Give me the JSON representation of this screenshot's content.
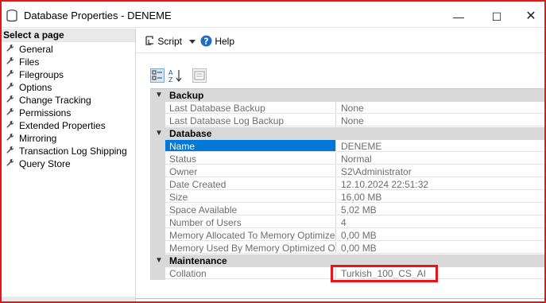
{
  "window": {
    "title": "Database Properties - DENEME",
    "minimize": "—",
    "maximize": "☐",
    "close": "✕"
  },
  "left_panel": {
    "header": "Select a page",
    "items": [
      {
        "label": "General"
      },
      {
        "label": "Files"
      },
      {
        "label": "Filegroups"
      },
      {
        "label": "Options"
      },
      {
        "label": "Change Tracking"
      },
      {
        "label": "Permissions"
      },
      {
        "label": "Extended Properties"
      },
      {
        "label": "Mirroring"
      },
      {
        "label": "Transaction Log Shipping"
      },
      {
        "label": "Query Store"
      }
    ]
  },
  "toolbar": {
    "script_label": "Script",
    "help_label": "Help"
  },
  "grid": {
    "categories": [
      {
        "name": "Backup",
        "rows": [
          {
            "name": "Last Database Backup",
            "value": "None"
          },
          {
            "name": "Last Database Log Backup",
            "value": "None"
          }
        ]
      },
      {
        "name": "Database",
        "rows": [
          {
            "name": "Name",
            "value": "DENEME",
            "selected": true
          },
          {
            "name": "Status",
            "value": "Normal"
          },
          {
            "name": "Owner",
            "value": "S2\\Administrator"
          },
          {
            "name": "Date Created",
            "value": "12.10.2024 22:51:32"
          },
          {
            "name": "Size",
            "value": "16,00 MB"
          },
          {
            "name": "Space Available",
            "value": "5,02 MB"
          },
          {
            "name": "Number of Users",
            "value": "4"
          },
          {
            "name": "Memory Allocated To Memory Optimized Obje",
            "value": "0,00 MB"
          },
          {
            "name": "Memory Used By Memory Optimized Objects",
            "value": "0,00 MB"
          }
        ]
      },
      {
        "name": "Maintenance",
        "rows": [
          {
            "name": "Collation",
            "value": "Turkish_100_CS_AI"
          }
        ]
      }
    ]
  },
  "colors": {
    "highlight": "#e8141a",
    "selection": "#0078d7",
    "category_bg": "#d9d9d9"
  }
}
